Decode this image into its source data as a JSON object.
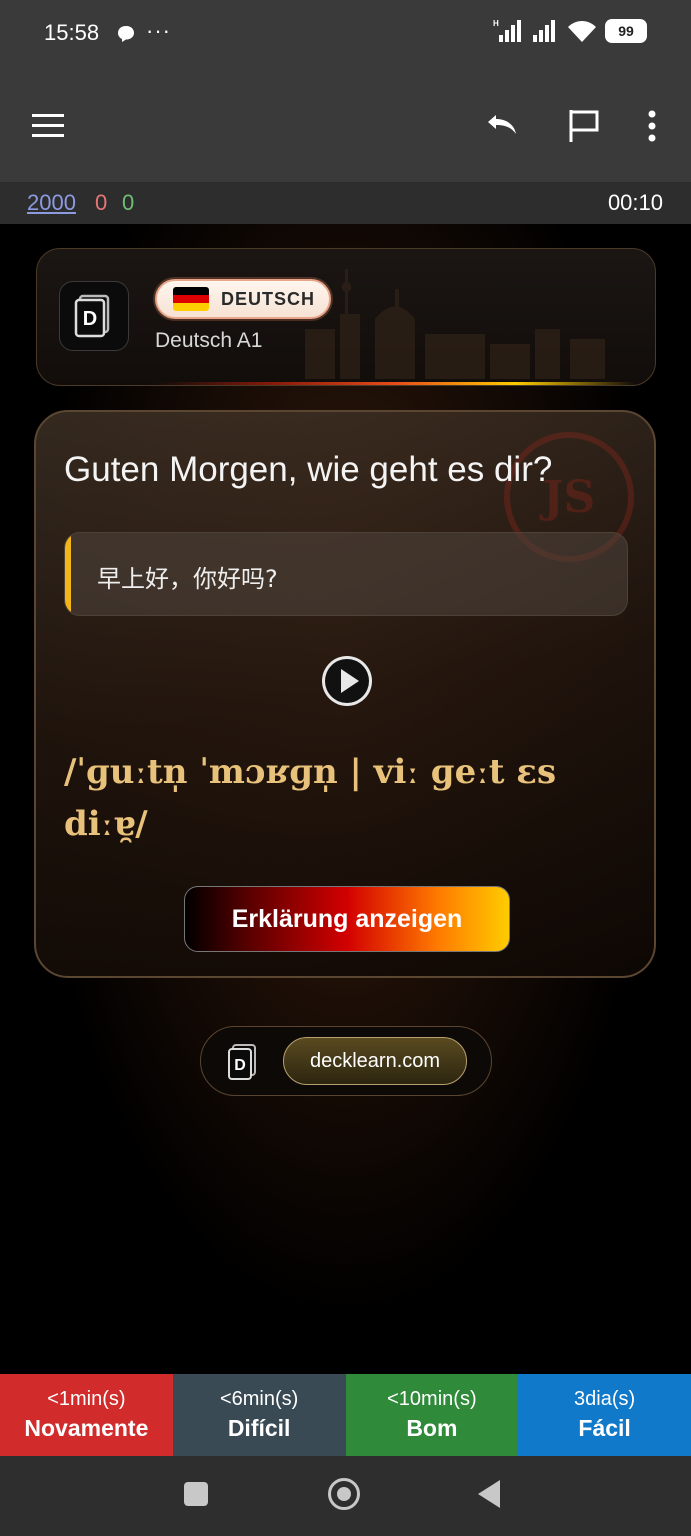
{
  "status_bar": {
    "time": "15:58",
    "dots": "···",
    "battery": "99"
  },
  "counts": {
    "new": "2000",
    "learning": "0",
    "review": "0",
    "timer": "00:10"
  },
  "deck": {
    "language_label": "DEUTSCH",
    "deck_name": "Deutsch A1"
  },
  "card": {
    "sentence": "Guten Morgen, wie geht es dir?",
    "translation": "早上好，你好吗?",
    "ipa": "/ˈɡuːtn̩ ˈmɔʁɡn̩ | viː ɡeːt ɛs diːɐ̯/",
    "explain_button": "Erklärung anzeigen"
  },
  "site": {
    "url": "decklearn.com"
  },
  "answers": [
    {
      "time": "<1min(s)",
      "label": "Novamente",
      "color": "#d12b2b"
    },
    {
      "time": "<6min(s)",
      "label": "Difícil",
      "color": "#3a4a54"
    },
    {
      "time": "<10min(s)",
      "label": "Bom",
      "color": "#2f8a3a"
    },
    {
      "time": "3dia(s)",
      "label": "Fácil",
      "color": "#1079c9"
    }
  ],
  "icons": [
    "menu-icon",
    "undo-icon",
    "flag-icon",
    "more-vert-icon",
    "play-icon",
    "signal-icon",
    "wifi-icon"
  ]
}
